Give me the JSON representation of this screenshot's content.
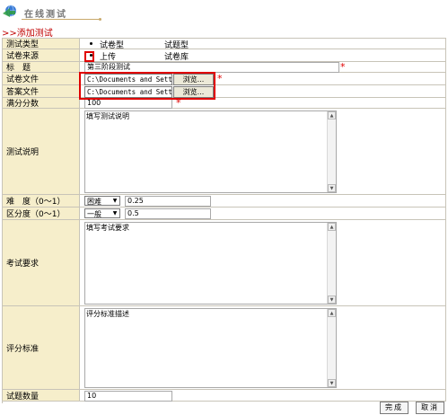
{
  "header": {
    "title": "在线测试"
  },
  "breadcrumb": ">>添加测试",
  "form": {
    "type": {
      "label": "测试类型",
      "options": [
        "试卷型",
        "试题型"
      ],
      "selected": "试卷型"
    },
    "source": {
      "label": "试卷来源",
      "options": [
        "上传",
        "试卷库"
      ],
      "selected": "上传"
    },
    "title": {
      "label": "标　题",
      "value": "第三阶段测试",
      "required": "*"
    },
    "paper_file": {
      "label": "试卷文件",
      "value": "C:\\Documents and Sett",
      "browse": "浏览...",
      "required": "*"
    },
    "answer_file": {
      "label": "答案文件",
      "value": "C:\\Documents and Sett",
      "browse": "浏览..."
    },
    "full_score": {
      "label": "满分分数",
      "value": "100",
      "required": "*"
    },
    "description": {
      "label": "测试说明",
      "value": "填写测试说明"
    },
    "difficulty": {
      "label": "难　度（0～1）",
      "select": "困难",
      "value": "0.25"
    },
    "discrimination": {
      "label": "区分度（0～1）",
      "select": "一般",
      "value": "0.5"
    },
    "requirement": {
      "label": "考试要求",
      "value": "填写考试要求"
    },
    "criteria": {
      "label": "评分标准",
      "value": "评分标准描述"
    },
    "question_count": {
      "label": "试题数量",
      "value": "10"
    }
  },
  "buttons": {
    "done": "完成",
    "cancel": "取消"
  },
  "colors": {
    "label_bg": "#f6eecb",
    "border": "#c8c4b8",
    "accent_red": "#e00000",
    "breadcrumb": "#c00000"
  }
}
